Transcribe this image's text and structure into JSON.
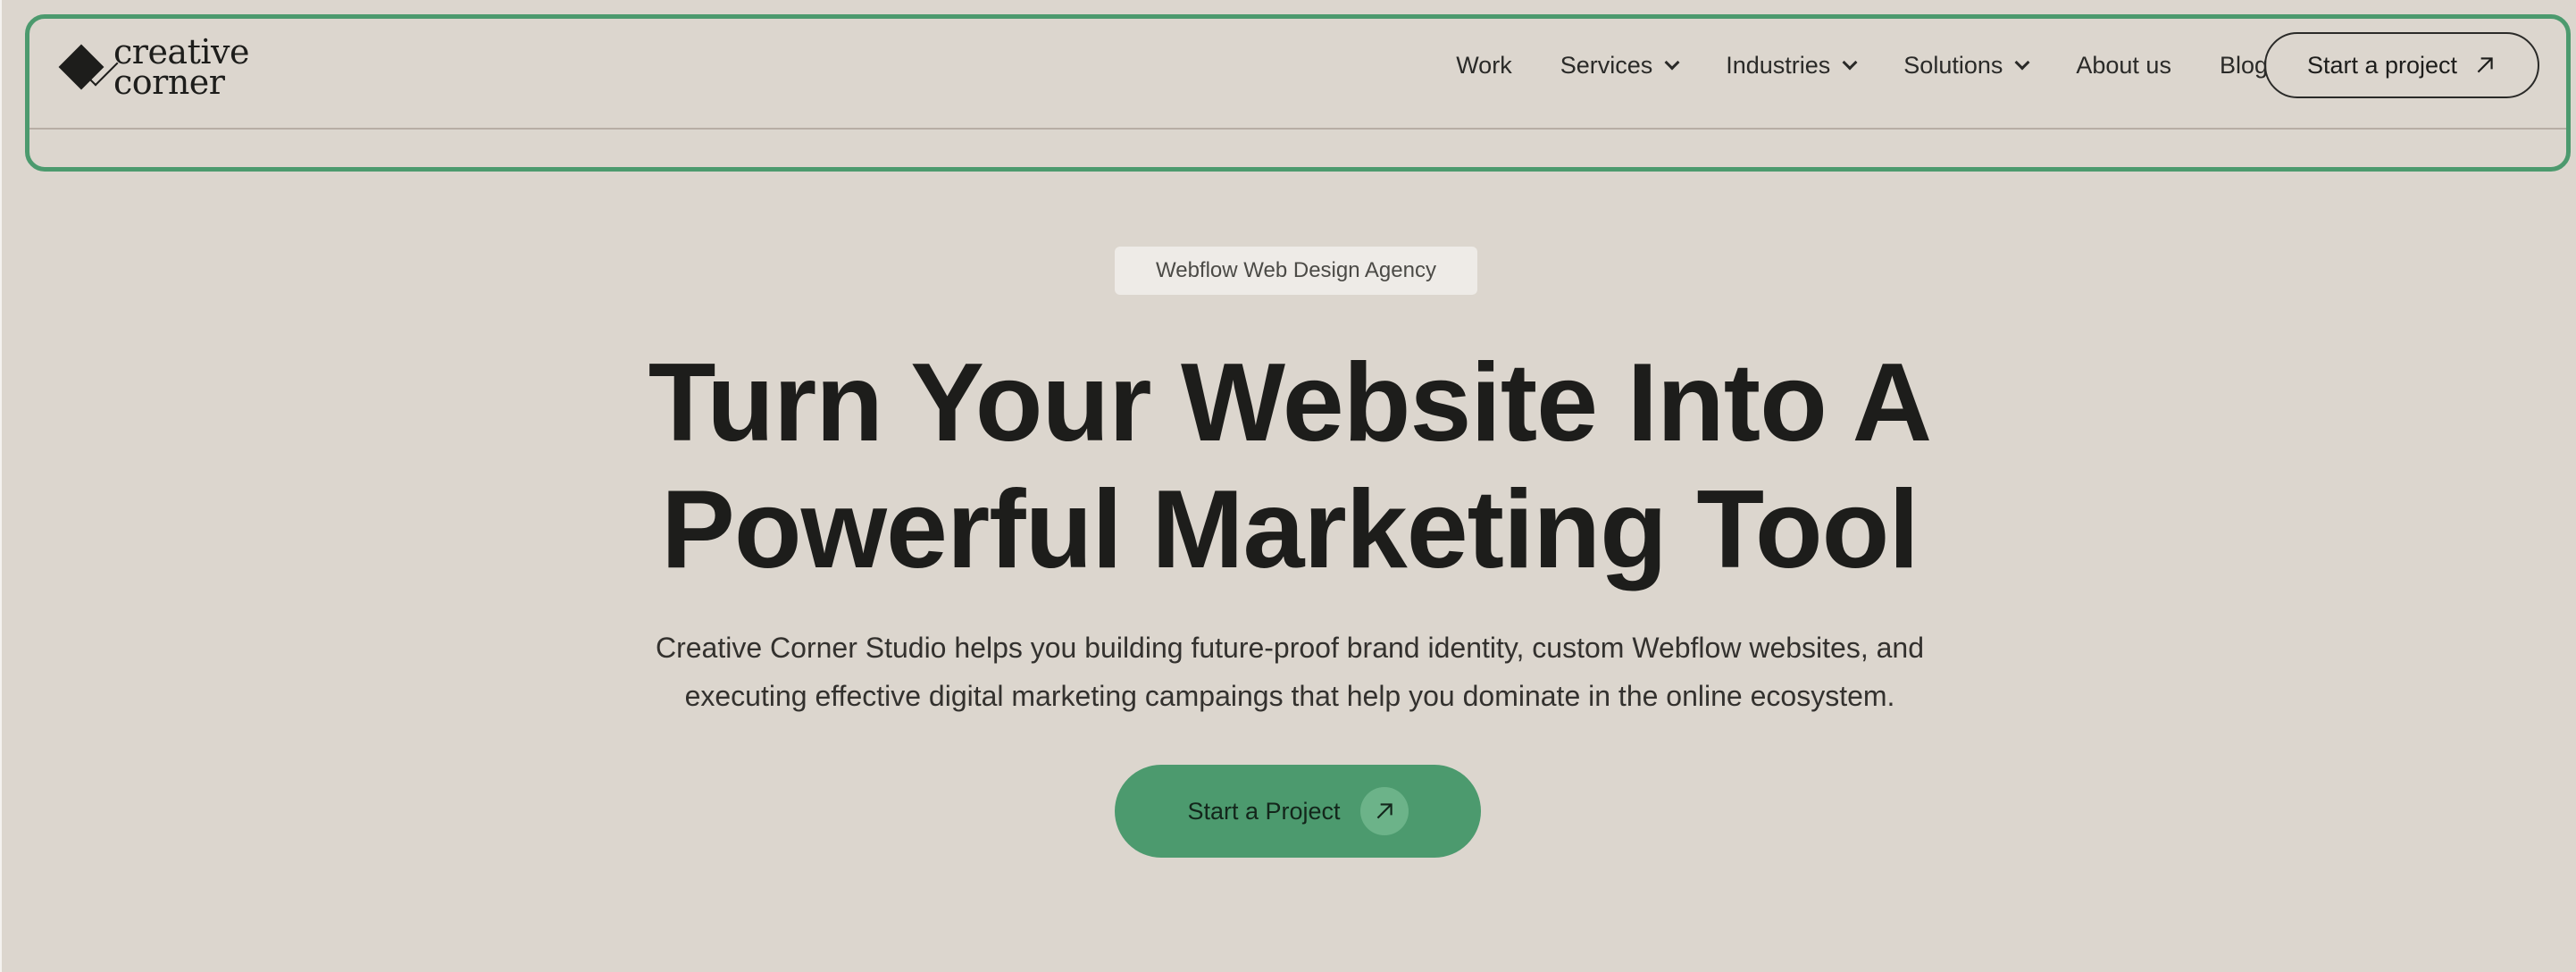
{
  "logo": {
    "line1": "creative",
    "line2": "corner"
  },
  "nav": {
    "items": [
      {
        "label": "Work",
        "dropdown": false
      },
      {
        "label": "Services",
        "dropdown": true
      },
      {
        "label": "Industries",
        "dropdown": true
      },
      {
        "label": "Solutions",
        "dropdown": true
      },
      {
        "label": "About us",
        "dropdown": false
      },
      {
        "label": "Blog",
        "dropdown": false
      }
    ],
    "cta_label": "Start a project"
  },
  "hero": {
    "badge": "Webflow Web Design Agency",
    "title_line1": "Turn Your Website Into A",
    "title_line2": "Powerful Marketing Tool",
    "subtitle_line1": "Creative Corner Studio helps you building future-proof brand identity, custom Webflow websites, and",
    "subtitle_line2": "executing effective digital marketing campaings that help you dominate in the online ecosystem.",
    "cta_label": "Start a Project"
  },
  "colors": {
    "background": "#dcd6ce",
    "accent": "#4c9a6e",
    "text": "#1d1d1b"
  },
  "icons": [
    "logo-diamond-icon",
    "chevron-down-icon",
    "arrow-up-right-icon"
  ]
}
